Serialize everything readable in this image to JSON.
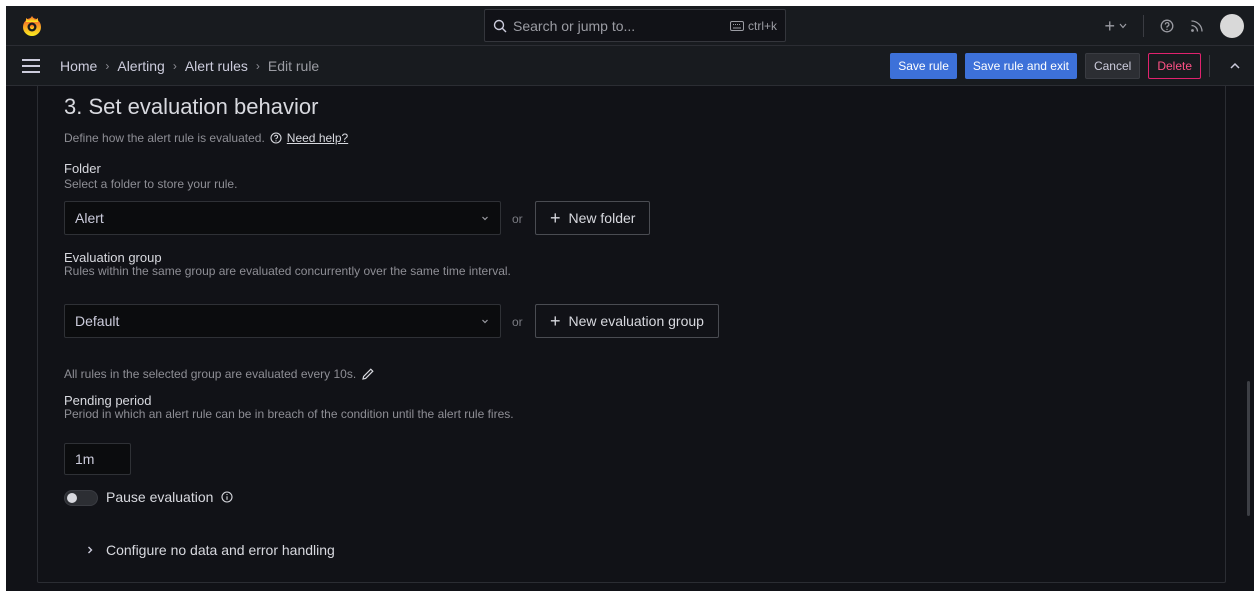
{
  "search": {
    "placeholder": "Search or jump to...",
    "shortcut": "ctrl+k"
  },
  "breadcrumb": {
    "items": [
      "Home",
      "Alerting",
      "Alert rules"
    ],
    "current": "Edit rule"
  },
  "actions": {
    "save": "Save rule",
    "save_exit": "Save rule and exit",
    "cancel": "Cancel",
    "delete": "Delete"
  },
  "section": {
    "title": "3. Set evaluation behavior",
    "description": "Define how the alert rule is evaluated.",
    "help_link": "Need help?"
  },
  "folder": {
    "label": "Folder",
    "description": "Select a folder to store your rule.",
    "value": "Alert",
    "or": "or",
    "new_button": "New folder"
  },
  "eval_group": {
    "label": "Evaluation group",
    "description": "Rules within the same group are evaluated concurrently over the same time interval.",
    "value": "Default",
    "or": "or",
    "new_button": "New evaluation group",
    "interval_text": "All rules in the selected group are evaluated every 10s."
  },
  "pending": {
    "label": "Pending period",
    "description": "Period in which an alert rule can be in breach of the condition until the alert rule fires.",
    "value": "1m"
  },
  "pause": {
    "label": "Pause evaluation",
    "enabled": false
  },
  "no_data": {
    "label": "Configure no data and error handling"
  },
  "colors": {
    "primary": "#3d71d9",
    "danger": "#e0226e",
    "background": "#111217",
    "panel": "#181b1f",
    "brand": "#f05a28"
  }
}
